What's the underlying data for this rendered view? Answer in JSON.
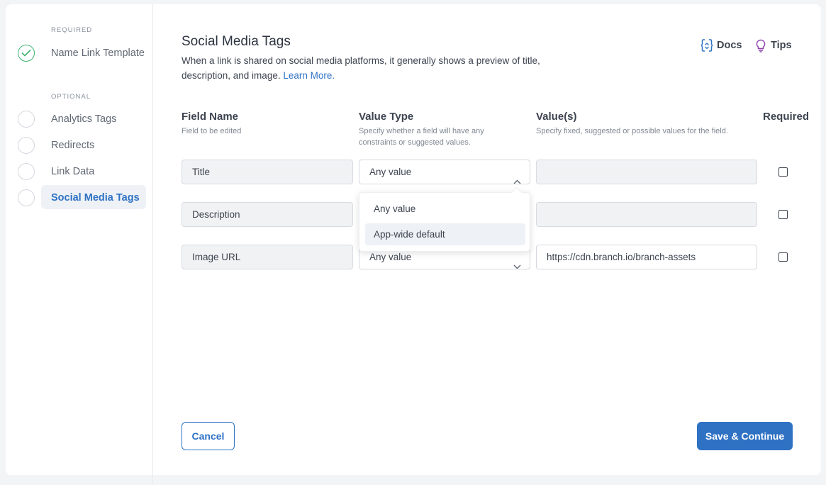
{
  "sidebar": {
    "required_label": "REQUIRED",
    "optional_label": "OPTIONAL",
    "steps": [
      {
        "label": "Name Link Template",
        "state": "done"
      },
      {
        "label": "Analytics Tags",
        "state": "pending"
      },
      {
        "label": "Redirects",
        "state": "pending"
      },
      {
        "label": "Link Data",
        "state": "pending"
      },
      {
        "label": "Social Media Tags",
        "state": "active"
      }
    ]
  },
  "header": {
    "title": "Social Media Tags",
    "description": "When a link is shared on social media platforms, it generally shows a preview of title, description, and image.",
    "learn_more": "Learn More.",
    "docs_label": "Docs",
    "tips_label": "Tips"
  },
  "columns": {
    "field_name": {
      "title": "Field Name",
      "subtitle": "Field to be edited"
    },
    "value_type": {
      "title": "Value Type",
      "subtitle": "Specify whether a field will have any constraints or suggested values."
    },
    "values": {
      "title": "Value(s)",
      "subtitle": "Specify fixed, suggested or possible values for the field."
    },
    "required": {
      "title": "Required"
    }
  },
  "rows": [
    {
      "field": "Title",
      "value_type": "Any value",
      "value": "",
      "required": false
    },
    {
      "field": "Description",
      "value_type": "Any value",
      "value": "",
      "required": false
    },
    {
      "field": "Image URL",
      "value_type": "Any value",
      "value": "https://cdn.branch.io/branch-assets",
      "required": false
    }
  ],
  "dropdown": {
    "options": [
      "Any value",
      "App-wide default"
    ],
    "highlighted": "App-wide default"
  },
  "footer": {
    "cancel_label": "Cancel",
    "save_label": "Save & Continue"
  },
  "colors": {
    "accent": "#2f72c4",
    "success": "#3cb371",
    "tips_icon": "#8e44ad"
  }
}
